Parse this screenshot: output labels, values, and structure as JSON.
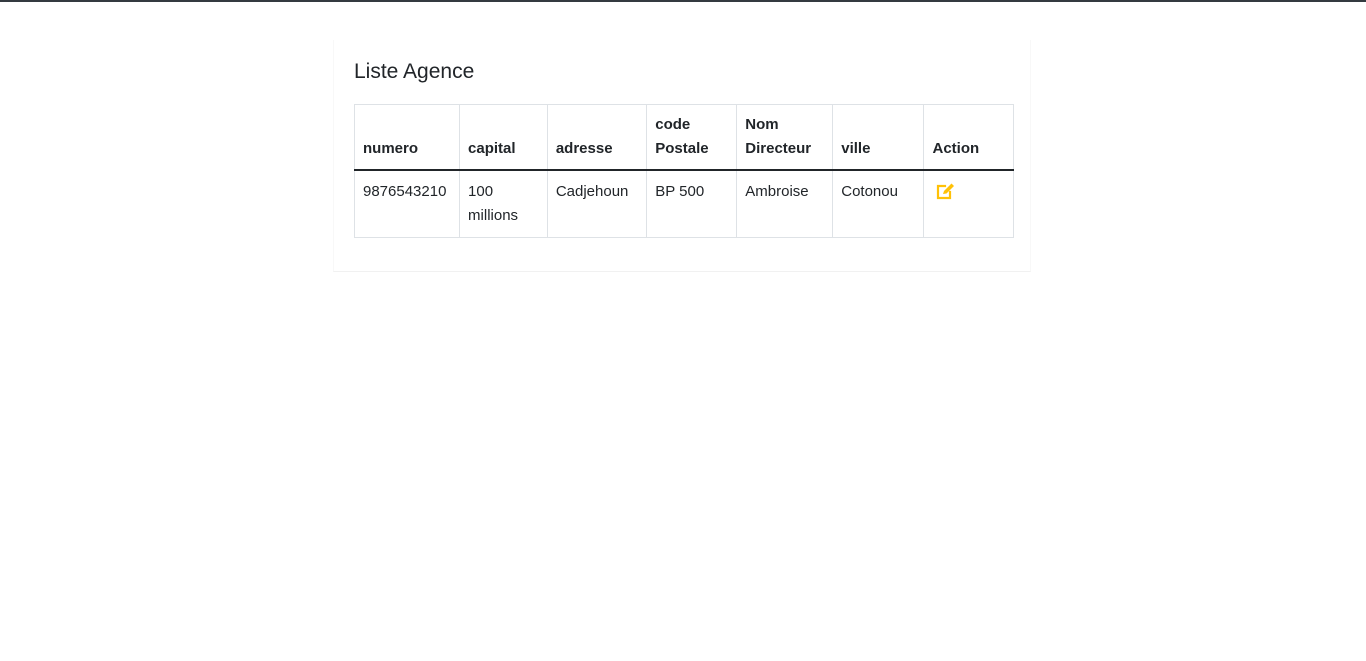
{
  "page": {
    "title": "Liste Agence"
  },
  "table": {
    "headers": [
      "numero",
      "capital",
      "adresse",
      "code Postale",
      "Nom Directeur",
      "ville",
      "Action"
    ],
    "rows": [
      {
        "numero": "9876543210",
        "capital": "100 millions",
        "adresse": "Cadjehoun",
        "code_postale": "BP 500",
        "nom_directeur": "Ambroise",
        "ville": "Cotonou",
        "action_icon": "edit-icon"
      }
    ]
  },
  "colors": {
    "action_icon": "#ffc107",
    "header_rule": "#212529",
    "top_bar": "#343a40"
  }
}
